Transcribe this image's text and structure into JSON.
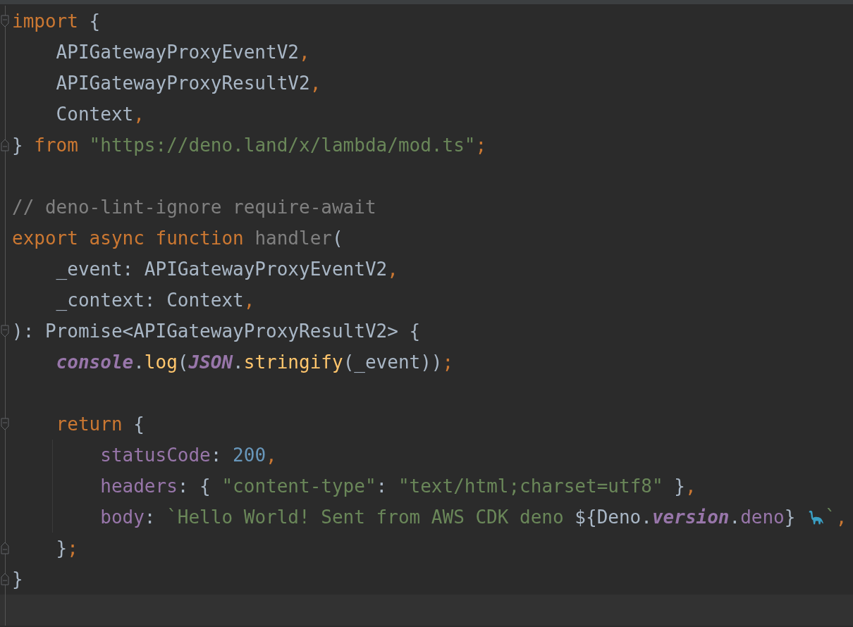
{
  "editor": {
    "lines": [
      {
        "fold_start": true,
        "fold_end": false,
        "guide": false,
        "tokens": [
          {
            "kind": "kw",
            "text": "import"
          },
          {
            "kind": "plain",
            "text": " {"
          }
        ]
      },
      {
        "fold_start": false,
        "fold_end": false,
        "guide": false,
        "tokens": [
          {
            "kind": "plain",
            "text": "    APIGatewayProxyEventV2"
          },
          {
            "kind": "punc",
            "text": ","
          }
        ]
      },
      {
        "fold_start": false,
        "fold_end": false,
        "guide": false,
        "tokens": [
          {
            "kind": "plain",
            "text": "    APIGatewayProxyResultV2"
          },
          {
            "kind": "punc",
            "text": ","
          }
        ]
      },
      {
        "fold_start": false,
        "fold_end": false,
        "guide": false,
        "tokens": [
          {
            "kind": "plain",
            "text": "    Context"
          },
          {
            "kind": "punc",
            "text": ","
          }
        ]
      },
      {
        "fold_start": false,
        "fold_end": true,
        "guide": false,
        "tokens": [
          {
            "kind": "plain",
            "text": "} "
          },
          {
            "kind": "kw",
            "text": "from "
          },
          {
            "kind": "str",
            "text": "\"https://deno.land/x/lambda/mod.ts\""
          },
          {
            "kind": "punc",
            "text": ";"
          }
        ]
      },
      {
        "fold_start": false,
        "fold_end": false,
        "guide": false
      },
      {
        "fold_start": false,
        "fold_end": false,
        "guide": false,
        "tokens": [
          {
            "kind": "comment",
            "text": "// deno-lint-ignore require-await"
          }
        ]
      },
      {
        "fold_start": false,
        "fold_end": false,
        "guide": false,
        "tokens": [
          {
            "kind": "kw",
            "text": "export async function "
          },
          {
            "kind": "unused",
            "text": "handler"
          },
          {
            "kind": "plain",
            "text": "("
          }
        ]
      },
      {
        "fold_start": false,
        "fold_end": false,
        "guide": false,
        "tokens": [
          {
            "kind": "plain",
            "text": "    _event: APIGatewayProxyEventV2"
          },
          {
            "kind": "punc",
            "text": ","
          }
        ]
      },
      {
        "fold_start": false,
        "fold_end": false,
        "guide": false,
        "tokens": [
          {
            "kind": "plain",
            "text": "    _context: Context"
          },
          {
            "kind": "punc",
            "text": ","
          }
        ]
      },
      {
        "fold_start": true,
        "fold_end": false,
        "guide": false,
        "tokens": [
          {
            "kind": "plain",
            "text": "): Promise<APIGatewayProxyResultV2> {"
          }
        ]
      },
      {
        "fold_start": false,
        "fold_end": false,
        "guide": false,
        "tokens": [
          {
            "kind": "global",
            "text": "    console"
          },
          {
            "kind": "plain",
            "text": "."
          },
          {
            "kind": "method",
            "text": "log"
          },
          {
            "kind": "plain",
            "text": "("
          },
          {
            "kind": "global",
            "text": "JSON"
          },
          {
            "kind": "plain",
            "text": "."
          },
          {
            "kind": "method",
            "text": "stringify"
          },
          {
            "kind": "plain",
            "text": "(_event))"
          },
          {
            "kind": "punc",
            "text": ";"
          }
        ]
      },
      {
        "fold_start": false,
        "fold_end": false,
        "guide": false
      },
      {
        "fold_start": true,
        "fold_end": false,
        "guide": false,
        "tokens": [
          {
            "kind": "kw",
            "text": "    return"
          },
          {
            "kind": "plain",
            "text": " {"
          }
        ]
      },
      {
        "fold_start": false,
        "fold_end": false,
        "guide": true,
        "tokens": [
          {
            "kind": "prop",
            "text": "        statusCode"
          },
          {
            "kind": "plain",
            "text": ": "
          },
          {
            "kind": "num",
            "text": "200"
          },
          {
            "kind": "punc",
            "text": ","
          }
        ]
      },
      {
        "fold_start": false,
        "fold_end": false,
        "guide": true,
        "tokens": [
          {
            "kind": "prop",
            "text": "        headers"
          },
          {
            "kind": "plain",
            "text": ": { "
          },
          {
            "kind": "str",
            "text": "\"content-type\""
          },
          {
            "kind": "plain",
            "text": ": "
          },
          {
            "kind": "str",
            "text": "\"text/html;charset=utf8\""
          },
          {
            "kind": "plain",
            "text": " }"
          },
          {
            "kind": "punc",
            "text": ","
          }
        ]
      },
      {
        "fold_start": false,
        "fold_end": false,
        "guide": true,
        "tokens": [
          {
            "kind": "prop",
            "text": "        body"
          },
          {
            "kind": "plain",
            "text": ": "
          },
          {
            "kind": "str",
            "text": "`Hello World! Sent from AWS CDK deno "
          },
          {
            "kind": "plain",
            "text": "${Deno."
          },
          {
            "kind": "global",
            "text": "version"
          },
          {
            "kind": "plain",
            "text": "."
          },
          {
            "kind": "prop",
            "text": "deno"
          },
          {
            "kind": "plain",
            "text": "} "
          },
          {
            "kind": "emoji"
          },
          {
            "kind": "str",
            "text": "`"
          },
          {
            "kind": "punc",
            "text": ","
          }
        ]
      },
      {
        "fold_start": false,
        "fold_end": true,
        "guide": false,
        "tokens": [
          {
            "kind": "plain",
            "text": "    }"
          },
          {
            "kind": "punc",
            "text": ";"
          }
        ]
      },
      {
        "fold_start": false,
        "fold_end": true,
        "guide": false,
        "tokens": [
          {
            "kind": "plain",
            "text": "}"
          }
        ]
      }
    ]
  }
}
